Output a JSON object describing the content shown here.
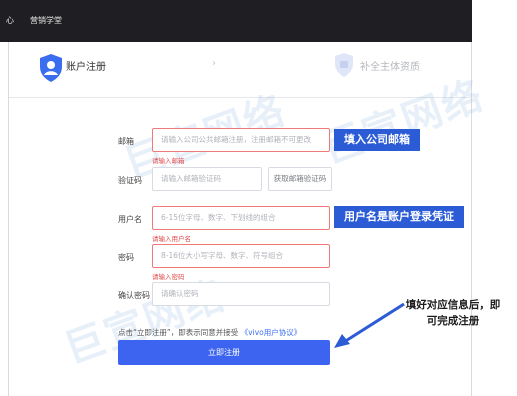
{
  "topbar": {
    "nav_a": "心",
    "nav_b": "营销学堂"
  },
  "steps": {
    "step1": "账户注册",
    "separator": "›",
    "step2": "补全主体资质"
  },
  "watermark": {
    "text1": "巨宣网络",
    "text2": "巨宣网络",
    "text3": "巨宣网络"
  },
  "form": {
    "email": {
      "label": "邮箱",
      "placeholder": "请输入公司公共邮箱注册，注册邮箱不可更改",
      "error": "请输入邮箱"
    },
    "code": {
      "label": "验证码",
      "placeholder": "请输入邮箱验证码",
      "button": "获取邮箱验证码"
    },
    "username": {
      "label": "用户名",
      "placeholder": "6-15位字母、数字、下划线的组合",
      "error": "请输入用户名"
    },
    "password": {
      "label": "密码",
      "placeholder": "8-16位大小写字母、数字、符号组合",
      "error": "请输入密码"
    },
    "confirm": {
      "label": "确认密码",
      "placeholder": "请确认密码"
    },
    "agree_prefix": "点击“立即注册”，即表示同意并接受",
    "agree_link": "《vivo用户协议》",
    "submit": "立即注册"
  },
  "callouts": {
    "email": "填入公司邮箱",
    "username": "用户名是账户登录凭证"
  },
  "annotation": {
    "line1": "填好对应信息后，即",
    "line2": "可完成注册"
  },
  "colors": {
    "callout_bg": "#2b5cd6",
    "submit_bg": "#3d64f0",
    "error": "#e04a4a",
    "link": "#3a6df0"
  }
}
